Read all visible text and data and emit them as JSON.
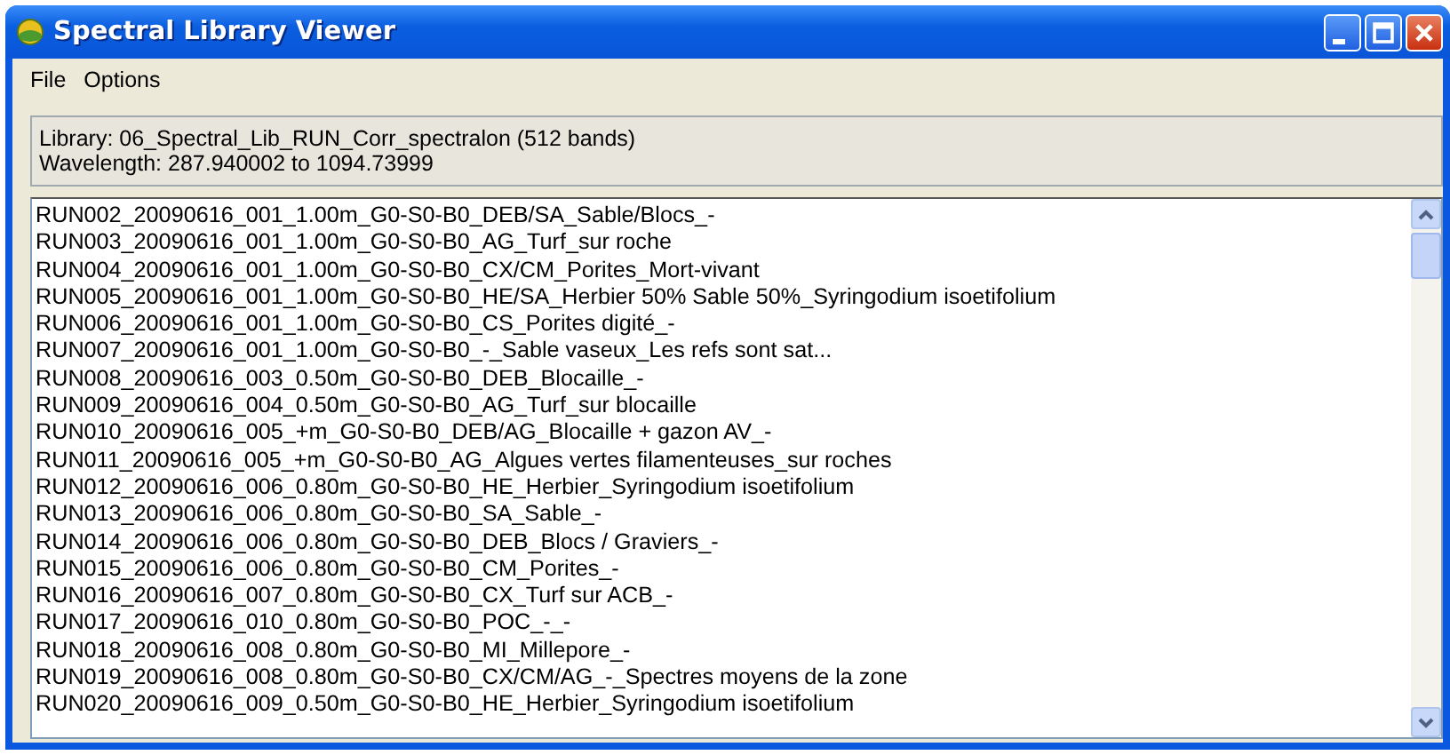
{
  "window": {
    "title": "Spectral Library Viewer"
  },
  "menu": [
    "File",
    "Options"
  ],
  "info": [
    "Library: 06_Spectral_Lib_RUN_Corr_spectralon (512 bands)",
    "Wavelength: 287.940002 to 1094.73999"
  ],
  "spectra": [
    "RUN002_20090616_001_1.00m_G0-S0-B0_DEB/SA_Sable/Blocs_-",
    "RUN003_20090616_001_1.00m_G0-S0-B0_AG_Turf_sur roche",
    "RUN004_20090616_001_1.00m_G0-S0-B0_CX/CM_Porites_Mort-vivant",
    "RUN005_20090616_001_1.00m_G0-S0-B0_HE/SA_Herbier 50% Sable 50%_Syringodium isoetifolium",
    "RUN006_20090616_001_1.00m_G0-S0-B0_CS_Porites digité_-",
    "RUN007_20090616_001_1.00m_G0-S0-B0_-_Sable vaseux_Les refs sont sat...",
    "RUN008_20090616_003_0.50m_G0-S0-B0_DEB_Blocaille_-",
    "RUN009_20090616_004_0.50m_G0-S0-B0_AG_Turf_sur blocaille",
    "RUN010_20090616_005_+m_G0-S0-B0_DEB/AG_Blocaille + gazon AV_-",
    "RUN011_20090616_005_+m_G0-S0-B0_AG_Algues vertes filamenteuses_sur roches",
    "RUN012_20090616_006_0.80m_G0-S0-B0_HE_Herbier_Syringodium isoetifolium",
    "RUN013_20090616_006_0.80m_G0-S0-B0_SA_Sable_-",
    "RUN014_20090616_006_0.80m_G0-S0-B0_DEB_Blocs / Graviers_-",
    "RUN015_20090616_006_0.80m_G0-S0-B0_CM_Porites_-",
    "RUN016_20090616_007_0.80m_G0-S0-B0_CX_Turf sur ACB_-",
    "RUN017_20090616_010_0.80m_G0-S0-B0_POC_-_-",
    "RUN018_20090616_008_0.80m_G0-S0-B0_MI_Millepore_-",
    "RUN019_20090616_008_0.80m_G0-S0-B0_CX/CM/AG_-_Spectres moyens de la zone",
    "RUN020_20090616_009_0.50m_G0-S0-B0_HE_Herbier_Syringodium isoetifolium"
  ]
}
